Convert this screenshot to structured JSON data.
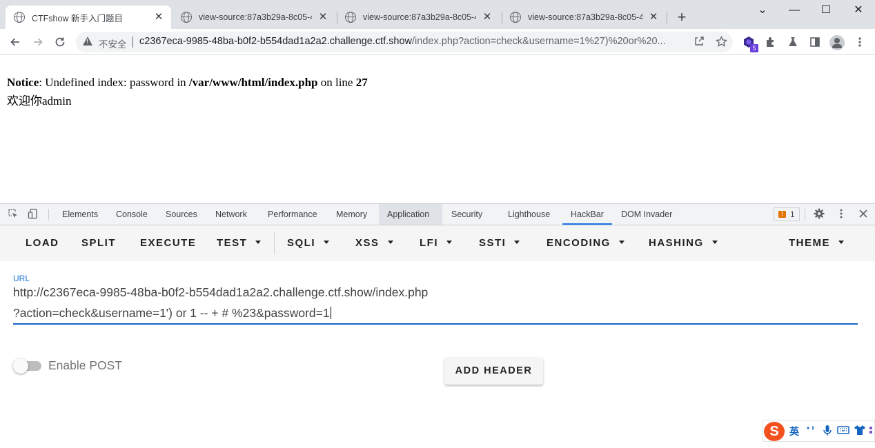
{
  "browser": {
    "tabs": [
      {
        "title": "CTFshow 新手入门题目",
        "active": true
      },
      {
        "title": "view-source:87a3b29a-8c05-4",
        "active": false
      },
      {
        "title": "view-source:87a3b29a-8c05-4",
        "active": false
      },
      {
        "title": "view-source:87a3b29a-8c05-4",
        "active": false
      }
    ],
    "new_tab": "+",
    "window_controls": {
      "dropdown": "⌄",
      "minimize": "—",
      "maximize": "☐",
      "close": "✕"
    },
    "tab_close": "✕",
    "address": {
      "security_label": "不安全",
      "url_host": "c2367eca-9985-48ba-b0f2-b554dad1a2a2.challenge.ctf.show",
      "url_rest": "/index.php?action=check&username=1%27)%20or%20..."
    },
    "extension_badge": "5"
  },
  "page": {
    "notice_label": "Notice",
    "notice_text": ": Undefined index: password in ",
    "notice_path": "/var/www/html/index.php",
    "notice_on_line": " on line ",
    "notice_line": "27",
    "welcome": "欢迎你admin"
  },
  "devtools": {
    "tabs": [
      "Elements",
      "Console",
      "Sources",
      "Network",
      "Performance",
      "Memory",
      "Application",
      "Security",
      "Lighthouse",
      "HackBar",
      "DOM Invader"
    ],
    "issues_count": "1",
    "issues_flag": "!"
  },
  "hackbar": {
    "menu": {
      "load": "LOAD",
      "split": "SPLIT",
      "execute": "EXECUTE",
      "test": "TEST",
      "sqli": "SQLI",
      "xss": "XSS",
      "lfi": "LFI",
      "ssti": "SSTI",
      "encoding": "ENCODING",
      "hashing": "HASHING",
      "theme": "THEME"
    },
    "url_label": "URL",
    "url_line1": "http://c2367eca-9985-48ba-b0f2-b554dad1a2a2.challenge.ctf.show/index.php",
    "url_line2": "?action=check&username=1') or 1 -- + # %23&password=1",
    "enable_post_label": "Enable POST",
    "enable_post": false,
    "add_header_label": "ADD HEADER"
  },
  "ime": {
    "logo": "S",
    "mode": "英"
  }
}
